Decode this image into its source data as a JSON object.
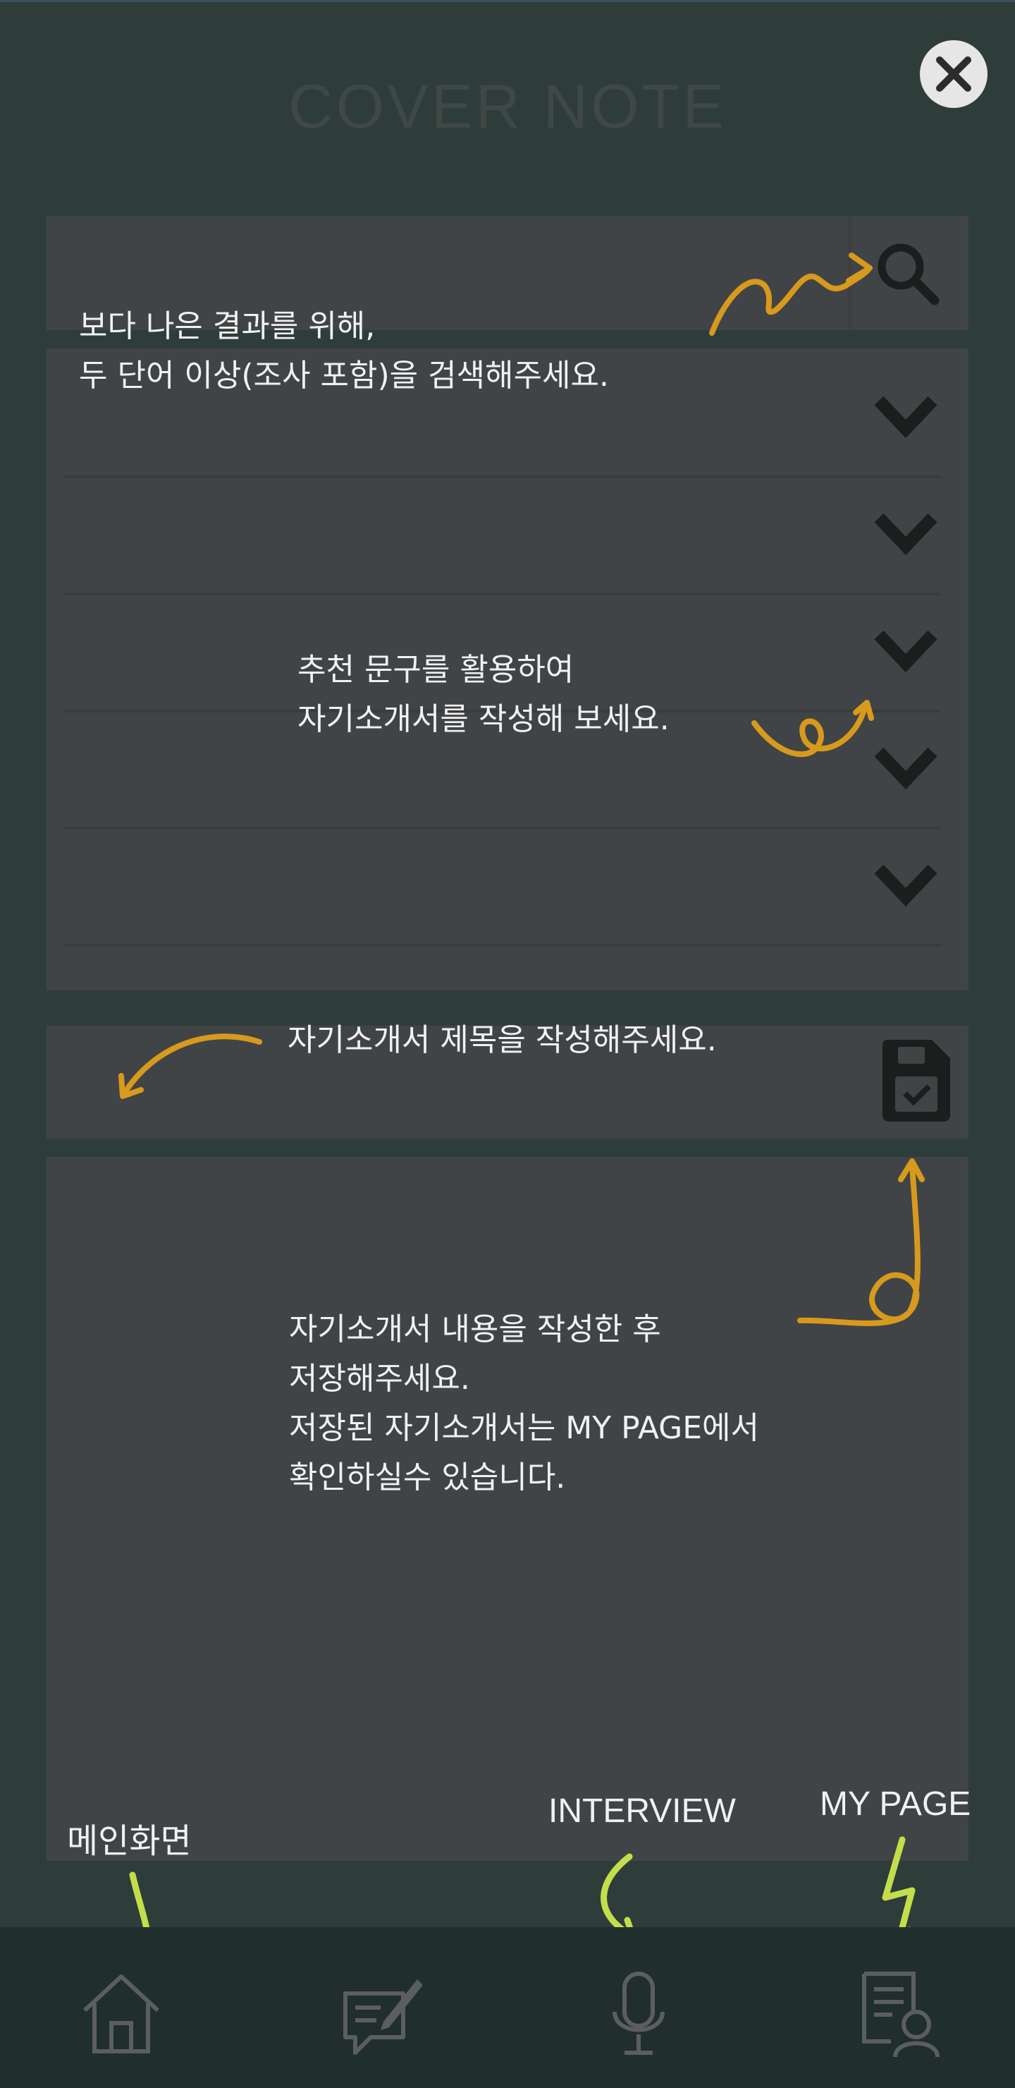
{
  "header": {
    "title": "COVER NOTE"
  },
  "tips": {
    "search": "보다 나은 결과를 위해,\n두 단어 이상(조사 포함)을 검색해주세요.",
    "recommend": "추천 문구를 활용하여\n자기소개서를 작성해 보세요.",
    "title": "자기소개서 제목을 작성해주세요.",
    "content": "자기소개서 내용을 작성한 후\n저장해주세요.\n저장된 자기소개서는 MY PAGE에서\n확인하실수 있습니다."
  },
  "nav_labels": {
    "home": "메인화면",
    "interview": "INTERVIEW",
    "mypage": "MY PAGE"
  },
  "icons": {
    "close": "close-icon",
    "search": "search-icon",
    "chevron": "chevron-down-icon",
    "save": "save-icon",
    "home": "home-icon",
    "write": "write-icon",
    "mic": "microphone-icon",
    "mypage": "profile-document-icon"
  },
  "colors": {
    "background": "#2e3d3a",
    "panel": "#414446",
    "nav": "#202e2c",
    "annotation_orange": "#d89a1c",
    "annotation_green": "#c4de4a"
  }
}
